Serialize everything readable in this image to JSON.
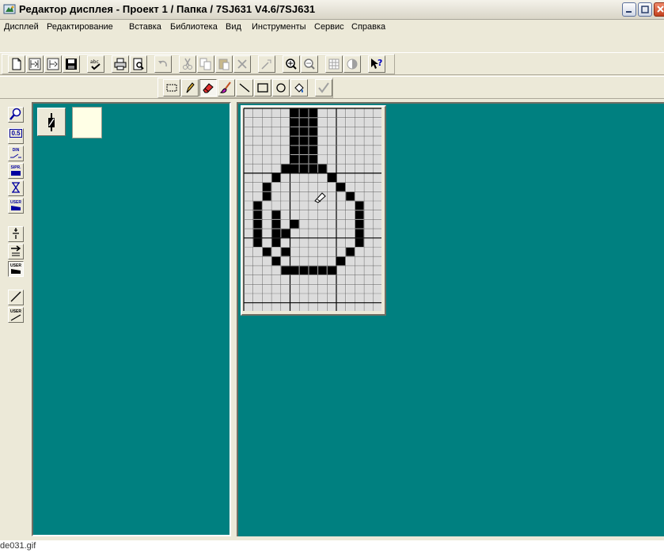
{
  "window": {
    "title": "Редактор дисплея - Проект 1 / Папка / 7SJ631 V4.6/7SJ631",
    "caption_buttons": [
      "minimize-icon",
      "maximize-icon",
      "close-icon"
    ]
  },
  "menu": [
    {
      "label": "Дисплей"
    },
    {
      "label": "Редактирование"
    },
    {
      "label": "Вставка"
    },
    {
      "label": "Библиотека"
    },
    {
      "label": "Вид"
    },
    {
      "label": "Инструменты"
    },
    {
      "label": "Сервис"
    },
    {
      "label": "Справка"
    }
  ],
  "toolbar_main": [
    "new-icon",
    "import-icon",
    "export-icon",
    "save-icon",
    "spellcheck-icon",
    "print-icon",
    "print-preview-icon",
    "undo-icon",
    "cut-icon",
    "copy-icon",
    "paste-icon",
    "delete-icon",
    "properties-icon",
    "zoom-in-icon",
    "zoom-out-icon",
    "grid-icon",
    "contrast-icon",
    "help-pointer-icon"
  ],
  "toolbar_draw": [
    "select-rect-icon",
    "pencil-icon",
    "eraser-icon",
    "brush-icon",
    "line-icon",
    "rectangle-icon",
    "ellipse-icon",
    "fill-icon",
    "check-icon"
  ],
  "left_tools": {
    "labels": {
      "scale": "0.5",
      "din": "DIN",
      "sipr": "SIPR.",
      "user1": "USER",
      "user2": "USER",
      "user3": "USER"
    }
  },
  "editor": {
    "grid_cols": 15,
    "grid_rows": 22,
    "selected_color": "#ffffe6",
    "accent": "#008080"
  },
  "caption": "de031.gif"
}
